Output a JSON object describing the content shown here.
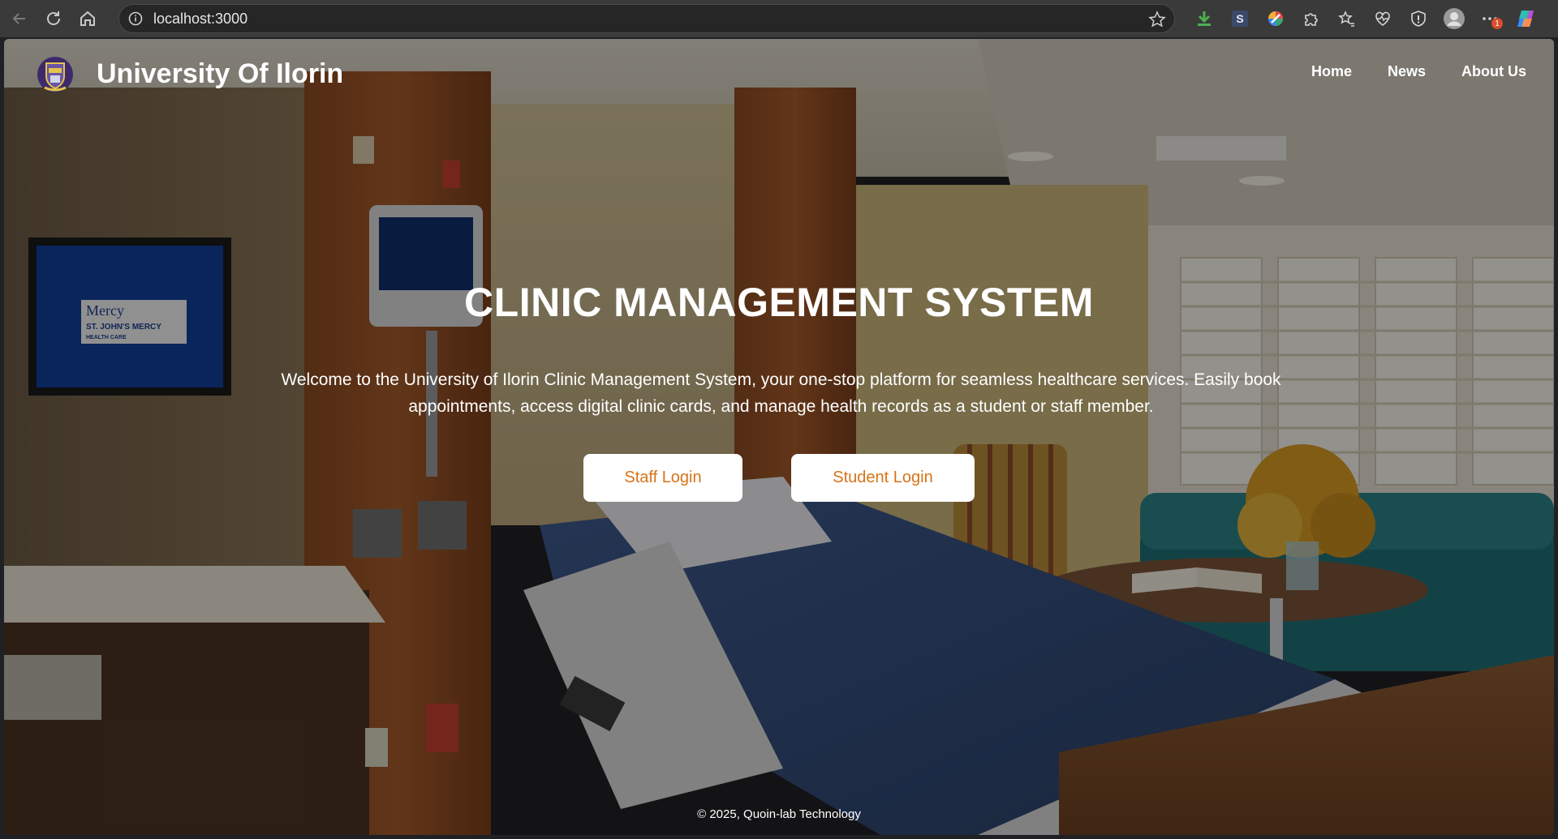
{
  "browser": {
    "url": "localhost:3000",
    "extensions": [
      "download-icon",
      "s-extension-icon",
      "color-wheel-icon",
      "puzzle-icon",
      "favorites-icon",
      "health-icon",
      "shield-icon",
      "profile-avatar-icon",
      "more-icon",
      "copilot-icon"
    ],
    "notification_badge": "1"
  },
  "site": {
    "brand": "University Of Ilorin",
    "nav": [
      "Home",
      "News",
      "About Us"
    ]
  },
  "hero": {
    "title": "CLINIC MANAGEMENT SYSTEM",
    "text": "Welcome to the University of Ilorin Clinic Management System, your one-stop platform for seamless healthcare services. Easily book appointments, access digital clinic cards, and manage health records as a student or staff member.",
    "staff_button": "Staff Login",
    "student_button": "Student Login"
  },
  "scene_text": {
    "monitor_brand": "Mercy",
    "monitor_line1": "ST. JOHN'S MERCY",
    "monitor_line2": "HEALTH CARE"
  },
  "footer": {
    "copyright": "© 2025, Quoin-lab Technology"
  },
  "colors": {
    "button_text": "#d77318",
    "overlay": "rgba(0,0,0,0.40)"
  }
}
